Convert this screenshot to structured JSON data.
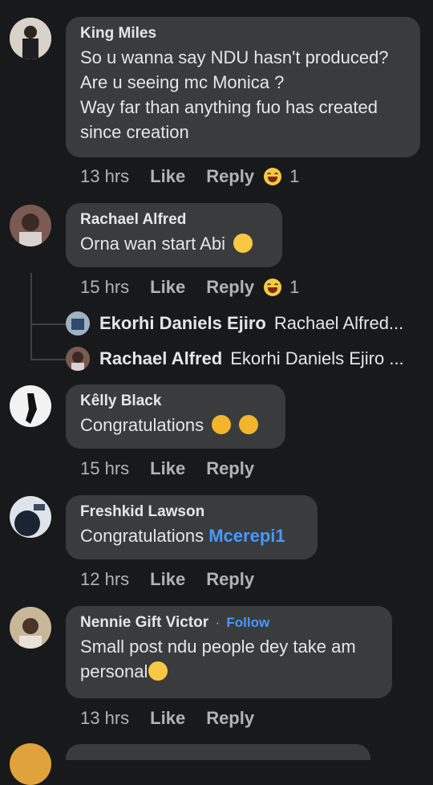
{
  "comments": [
    {
      "author": "King Miles",
      "lines": [
        "So u wanna say NDU hasn't produced?",
        "Are u seeing mc Monica ?",
        "Way far than anything fuo has created",
        "since creation"
      ],
      "time": "13 hrs",
      "like": "Like",
      "reply": "Reply",
      "reaction_count": "1"
    },
    {
      "author": "Rachael Alfred",
      "text": "Orna wan start Abi",
      "time": "15 hrs",
      "like": "Like",
      "reply": "Reply",
      "reaction_count": "1",
      "replies": [
        {
          "author": "Ekorhi Daniels Ejiro",
          "preview": "Rachael Alfred..."
        },
        {
          "author": "Rachael Alfred",
          "preview": "Ekorhi Daniels Ejiro ..."
        }
      ]
    },
    {
      "author": "Kêlly Black",
      "text": "Congratulations",
      "time": "15 hrs",
      "like": "Like",
      "reply": "Reply"
    },
    {
      "author": "Freshkid Lawson",
      "text": "Congratulations",
      "mention": "Mcerepi1",
      "time": "12 hrs",
      "like": "Like",
      "reply": "Reply"
    },
    {
      "author": "Nennie Gift Victor",
      "follow": "Follow",
      "lines": [
        "Small post ndu people dey take am",
        "personal"
      ],
      "time": "13 hrs",
      "like": "Like",
      "reply": "Reply"
    }
  ],
  "colors": {
    "background": "#18191a",
    "bubble": "#3a3b3c",
    "link": "#4599ff",
    "muted": "#b0b3b8"
  }
}
